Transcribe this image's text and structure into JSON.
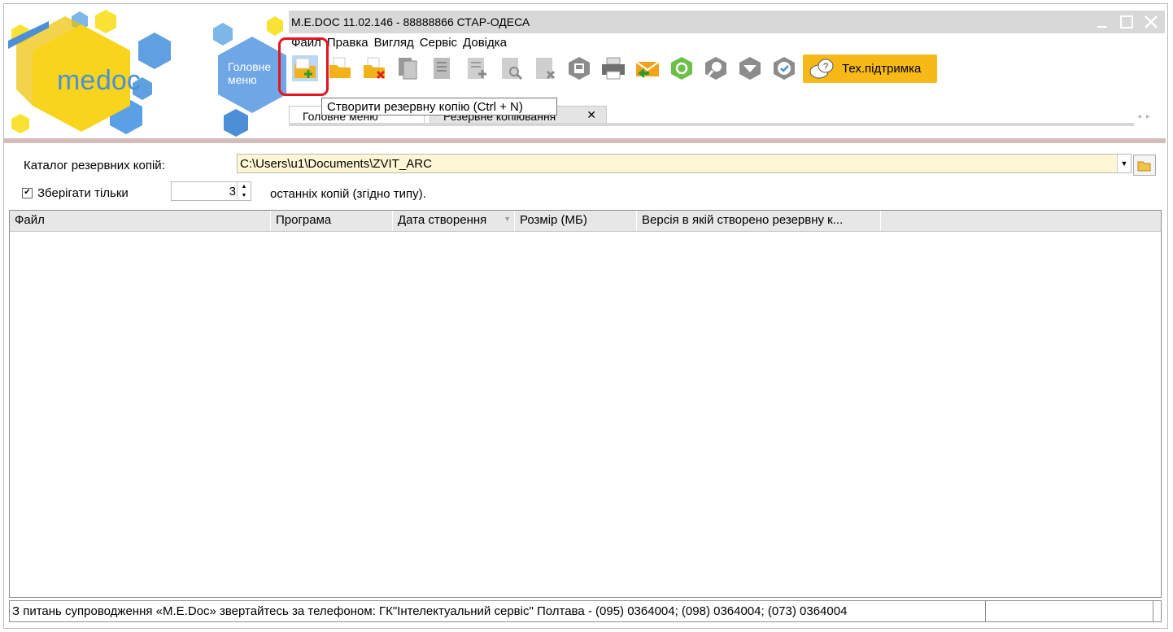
{
  "brand": {
    "logo_text_me": "me",
    "logo_text_doc": "doc",
    "main_menu_label_line1": "Головне",
    "main_menu_label_line2": "меню"
  },
  "window": {
    "title": "M.E.DOC 11.02.146  - 88888866 СТАР-ОДЕСА"
  },
  "menu": [
    "Файл",
    "Правка",
    "Вигляд",
    "Сервіс",
    "Довідка"
  ],
  "toolbar": {
    "buttons": [
      {
        "name": "create-backup",
        "icon": "folder-plus-icon"
      },
      {
        "name": "open-folder",
        "icon": "folder-icon"
      },
      {
        "name": "delete-folder",
        "icon": "folder-delete-icon"
      },
      {
        "name": "copy-doc",
        "icon": "copy-icon"
      },
      {
        "name": "doc-edit",
        "icon": "document-icon"
      },
      {
        "name": "doc-add",
        "icon": "document-add-icon"
      },
      {
        "name": "doc-search",
        "icon": "document-search-icon"
      },
      {
        "name": "doc-remove",
        "icon": "document-remove-icon"
      },
      {
        "name": "save",
        "icon": "save-icon"
      },
      {
        "name": "print",
        "icon": "printer-icon"
      },
      {
        "name": "mail",
        "icon": "mail-icon"
      },
      {
        "name": "refresh",
        "icon": "refresh-icon"
      },
      {
        "name": "search",
        "icon": "search-icon"
      },
      {
        "name": "inbox",
        "icon": "inbox-icon"
      },
      {
        "name": "check",
        "icon": "check-icon"
      }
    ],
    "support_label": "Тех.підтримка"
  },
  "tooltip": "Створити резервну копію (Ctrl + N)",
  "tabs": [
    {
      "label": "Головне меню"
    },
    {
      "label": "Резервне копіювання"
    }
  ],
  "form": {
    "catalog_label": "Каталог резервних копій:",
    "catalog_value": "C:\\Users\\u1\\Documents\\ZVIT_ARC",
    "keep_label": "Зберігати тільки",
    "keep_checked": true,
    "keep_value": "3",
    "keep_suffix": "останніх копій (згідно типу)."
  },
  "grid": {
    "columns": [
      "Файл",
      "Програма",
      "Дата створення",
      "Розмір (МБ)",
      "Версія в якій створено резервну к..."
    ],
    "rows": []
  },
  "status": {
    "message": "З питань супроводження «M.E.Doc» звертайтесь за телефоном: ГК\"Інтелектуальний сервіс\" Полтава - (095) 0364004;  (098) 0364004;  (073) 0364004"
  },
  "colors": {
    "accent_yellow": "#f6b918",
    "hex_blue": "#4c8fd6",
    "highlight_red": "#e3151e"
  }
}
